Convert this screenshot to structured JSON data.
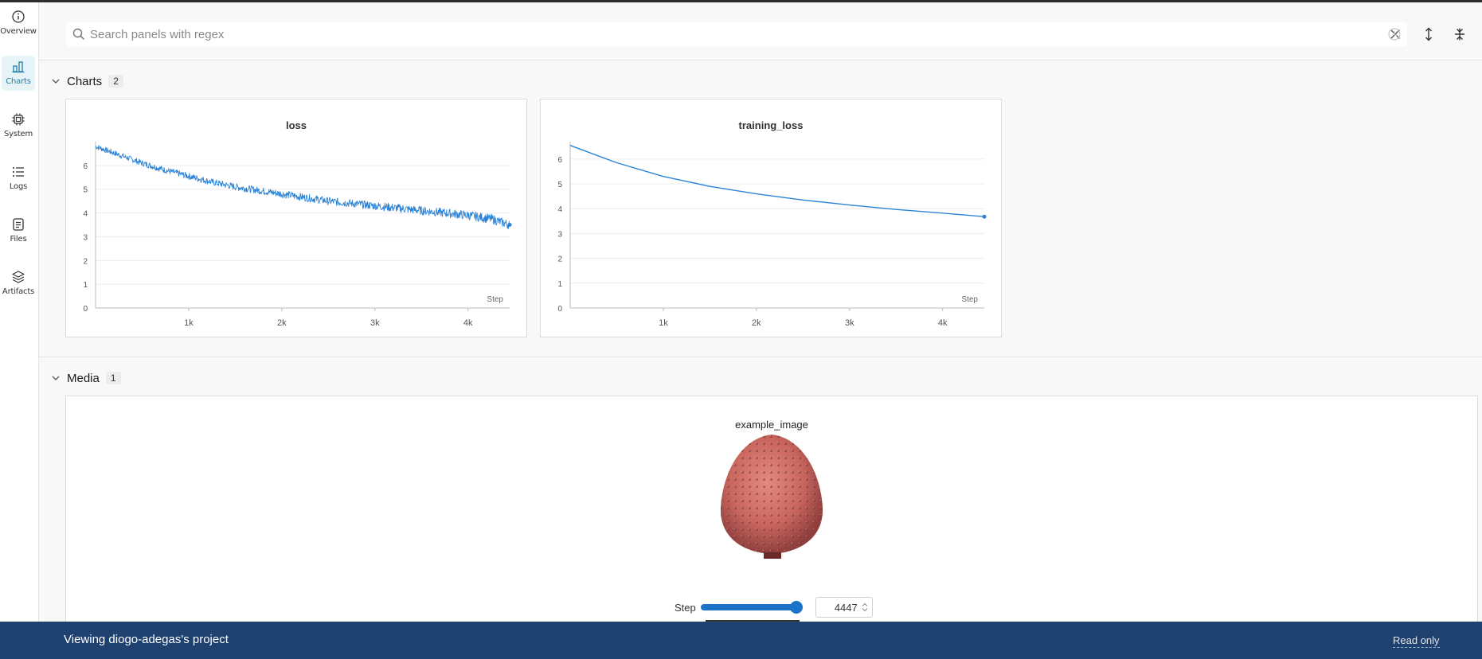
{
  "sidebar": {
    "items": [
      {
        "label": "Overview",
        "icon": "info-icon"
      },
      {
        "label": "Charts",
        "icon": "bar-chart-icon"
      },
      {
        "label": "System",
        "icon": "cpu-icon"
      },
      {
        "label": "Logs",
        "icon": "list-icon"
      },
      {
        "label": "Files",
        "icon": "file-icon"
      },
      {
        "label": "Artifacts",
        "icon": "layers-icon"
      }
    ],
    "active": "Charts"
  },
  "search": {
    "placeholder": "Search panels with regex",
    "value": ""
  },
  "sections": {
    "charts": {
      "title": "Charts",
      "count": "2"
    },
    "media": {
      "title": "Media",
      "count": "1"
    }
  },
  "colors": {
    "accent": "#1a73c7",
    "line": "#2b83d6",
    "footer": "#1e4170",
    "active_bg": "#e6f4f8"
  },
  "chart_data": [
    {
      "type": "line",
      "title": "loss",
      "xlabel": "Step",
      "ylabel": "",
      "xlim": [
        0,
        4447
      ],
      "ylim": [
        0,
        7
      ],
      "xticks": [
        "1k",
        "2k",
        "3k",
        "4k"
      ],
      "yticks": [
        "0",
        "1",
        "2",
        "3",
        "4",
        "5",
        "6"
      ],
      "noisy": true,
      "series": [
        {
          "x": [
            0,
            250,
            500,
            750,
            1000,
            1250,
            1500,
            1750,
            2000,
            2250,
            2500,
            2750,
            3000,
            3250,
            3500,
            3750,
            4000,
            4250,
            4447
          ],
          "y": [
            6.8,
            6.45,
            6.1,
            5.8,
            5.55,
            5.3,
            5.1,
            4.95,
            4.8,
            4.65,
            4.5,
            4.4,
            4.3,
            4.2,
            4.1,
            4.0,
            3.9,
            3.75,
            3.5
          ]
        }
      ]
    },
    {
      "type": "line",
      "title": "training_loss",
      "xlabel": "Step",
      "ylabel": "",
      "xlim": [
        0,
        4447
      ],
      "ylim": [
        0,
        6.7
      ],
      "xticks": [
        "1k",
        "2k",
        "3k",
        "4k"
      ],
      "yticks": [
        "0",
        "1",
        "2",
        "3",
        "4",
        "5",
        "6"
      ],
      "noisy": false,
      "series": [
        {
          "x": [
            0,
            500,
            1000,
            1500,
            2000,
            2500,
            3000,
            3500,
            4000,
            4447
          ],
          "y": [
            6.55,
            5.85,
            5.3,
            4.9,
            4.6,
            4.35,
            4.15,
            3.97,
            3.82,
            3.68
          ]
        }
      ]
    }
  ],
  "media": {
    "title": "example_image",
    "step_label": "Step",
    "step_value": "4447",
    "slider_fraction": 1.0
  },
  "footer": {
    "text": "Viewing diogo-adegas's project",
    "read_only": "Read only"
  }
}
